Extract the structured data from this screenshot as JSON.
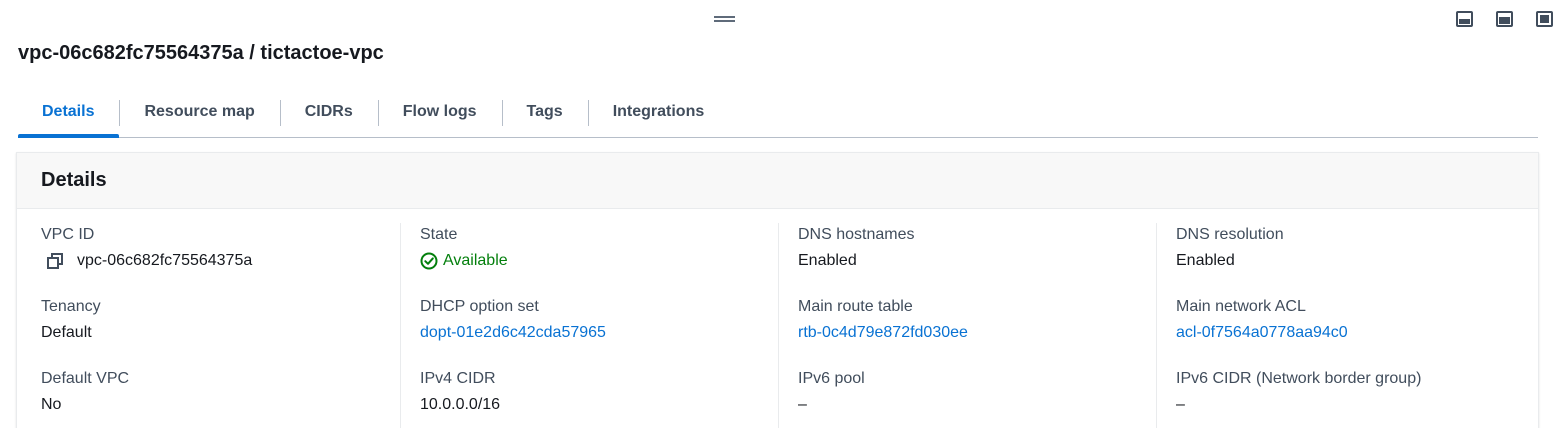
{
  "header": {
    "title": "vpc-06c682fc75564375a / tictactoe-vpc"
  },
  "tabs": [
    {
      "label": "Details",
      "active": true
    },
    {
      "label": "Resource map",
      "active": false
    },
    {
      "label": "CIDRs",
      "active": false
    },
    {
      "label": "Flow logs",
      "active": false
    },
    {
      "label": "Tags",
      "active": false
    },
    {
      "label": "Integrations",
      "active": false
    }
  ],
  "details": {
    "heading": "Details",
    "vpc_id": {
      "label": "VPC ID",
      "value": "vpc-06c682fc75564375a",
      "icon": "copy-icon"
    },
    "state": {
      "label": "State",
      "value": "Available",
      "icon": "check-circle-icon"
    },
    "dns_hostnames": {
      "label": "DNS hostnames",
      "value": "Enabled"
    },
    "dns_resolution": {
      "label": "DNS resolution",
      "value": "Enabled"
    },
    "tenancy": {
      "label": "Tenancy",
      "value": "Default"
    },
    "dhcp_option_set": {
      "label": "DHCP option set",
      "value": "dopt-01e2d6c42cda57965"
    },
    "main_route_table": {
      "label": "Main route table",
      "value": "rtb-0c4d79e872fd030ee"
    },
    "main_network_acl": {
      "label": "Main network ACL",
      "value": "acl-0f7564a0778aa94c0"
    },
    "default_vpc": {
      "label": "Default VPC",
      "value": "No"
    },
    "ipv4_cidr": {
      "label": "IPv4 CIDR",
      "value": "10.0.0.0/16"
    },
    "ipv6_pool": {
      "label": "IPv6 pool",
      "value": "–"
    },
    "ipv6_cidr": {
      "label": "IPv6 CIDR (Network border group)",
      "value": "–"
    }
  },
  "colors": {
    "link": "#0972d3",
    "success": "#037f0c",
    "text": "#16191f",
    "label": "#414d5c"
  }
}
